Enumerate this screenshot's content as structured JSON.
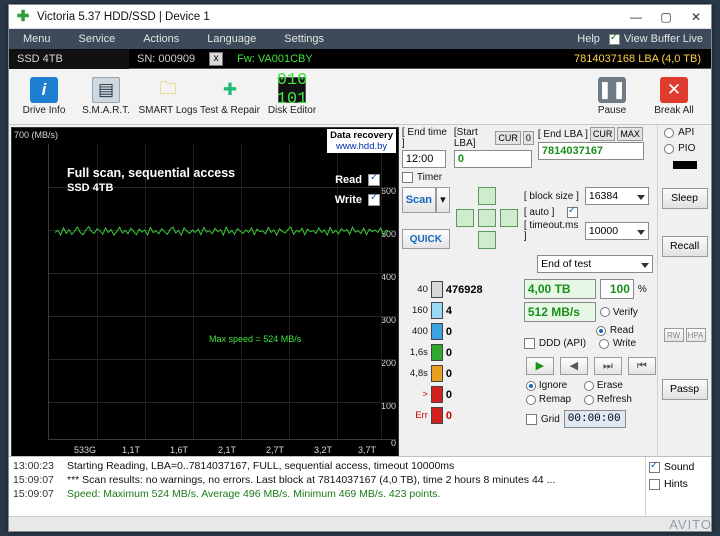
{
  "window": {
    "title": "Victoria 5.37 HDD/SSD | Device 1",
    "logo": "cross-icon",
    "minimize": "—",
    "maximize": "▢",
    "close": "✕"
  },
  "menu": {
    "items": [
      "Menu",
      "Service",
      "Actions",
      "Language",
      "Settings"
    ],
    "help": "Help",
    "view_buffer_live": "View Buffer Live"
  },
  "drivebar": {
    "model": "SSD 4TB",
    "sn_label": "SN: 000909",
    "close_drive": "x",
    "fw": "Fw: VA001CBY",
    "lba": "7814037168 LBA (4,0 TB)"
  },
  "toolbar": {
    "buttons": [
      {
        "label": "Drive Info",
        "icon": "info-icon"
      },
      {
        "label": "S.M.A.R.T.",
        "icon": "smart-table-icon"
      },
      {
        "label": "SMART Logs",
        "icon": "folder-icon"
      },
      {
        "label": "Test & Repair",
        "icon": "tools-icon"
      },
      {
        "label": "Disk Editor",
        "icon": "hex-editor-icon"
      }
    ],
    "pause": {
      "label": "Pause",
      "icon": "pause-icon"
    },
    "break_all": {
      "label": "Break All",
      "icon": "stop-icon"
    }
  },
  "graph": {
    "unit": "700 (MB/s)",
    "y_ticks": [
      "600",
      "500",
      "400",
      "300",
      "200",
      "100",
      "0"
    ],
    "x_ticks": [
      "533G",
      "1,1T",
      "1,6T",
      "2,1T",
      "2,7T",
      "3,2T",
      "3,7T"
    ],
    "title": "Full scan, sequential access",
    "subtitle": "SSD 4TB",
    "read_label": "Read",
    "write_label": "Write",
    "watermark_top": "Data recovery",
    "watermark_bottom": "www.hdd.by",
    "max_speed_note": "Max speed = 524 MB/s"
  },
  "chart_data": {
    "type": "line",
    "title": "Full scan, sequential access",
    "xlabel": "",
    "ylabel": "MB/s",
    "ylim": [
      0,
      700
    ],
    "x_tick_labels": [
      "533G",
      "1,1T",
      "1,6T",
      "2,1T",
      "2,7T",
      "3,2T",
      "3,7T"
    ],
    "y_tick_labels": [
      "700",
      "600",
      "500",
      "400",
      "300",
      "200",
      "100",
      "0"
    ],
    "series": [
      {
        "name": "Read",
        "color": "#35c935",
        "values": [
          492,
          497,
          486,
          503,
          490,
          499,
          488,
          495,
          505,
          492,
          487,
          498,
          506,
          494,
          490,
          501,
          496,
          488,
          503,
          492,
          499,
          486,
          494,
          505,
          491,
          497,
          489,
          502,
          495,
          487,
          500,
          493,
          498,
          486,
          504,
          492,
          496,
          489,
          501,
          494,
          488,
          499,
          505,
          491,
          497,
          486,
          503,
          495,
          490,
          498,
          492,
          500,
          487,
          504,
          493,
          496,
          489,
          502,
          494,
          499,
          486,
          505,
          491,
          497,
          488,
          501,
          495,
          490,
          498,
          492,
          503,
          487,
          500,
          494,
          496,
          489,
          504,
          492,
          498,
          486,
          501,
          495,
          491,
          499,
          505,
          488,
          497,
          493,
          502,
          487,
          500,
          494,
          496,
          490,
          503,
          492,
          498,
          486,
          504,
          491,
          497,
          489,
          501,
          495,
          499,
          488,
          505,
          493,
          496,
          490,
          502,
          487,
          500,
          494,
          498,
          492,
          503,
          486,
          497,
          495
        ]
      }
    ],
    "annotations": [
      "Max speed = 524 MB/s"
    ],
    "grid": true,
    "legend_position": "top-right"
  },
  "controls": {
    "end_time_label": "[ End time ]",
    "end_time_value": "12:00",
    "start_lba_label": "[Start LBA]",
    "start_lba_cur": "CUR",
    "start_lba_zero": "0",
    "start_lba_value": "0",
    "end_lba_label": "[ End LBA ]",
    "end_lba_cur": "CUR",
    "end_lba_max": "MAX",
    "end_lba_value": "7814037167",
    "timer_label": "Timer",
    "scan_button": "Scan",
    "quick_button": "QUICK",
    "block_size_label": "[ block size ]",
    "block_size_value": "16384",
    "auto_label": "[ auto ]",
    "timeout_label": "[ timeout.ms ]",
    "timeout_value": "10000",
    "end_of_test": "End of test"
  },
  "blocks": {
    "rows": [
      {
        "time": "40",
        "count": "476928",
        "color": "#d8d8d8"
      },
      {
        "time": "160",
        "count": "4",
        "color": "#9ad9f5"
      },
      {
        "time": "400",
        "count": "0",
        "color": "#3aa3e0"
      },
      {
        "time": "1,6s",
        "count": "0",
        "color": "#2fa82f"
      },
      {
        "time": "4,8s",
        "count": "0",
        "color": "#e8a020"
      },
      {
        "time": ">",
        "count": "0",
        "color": "#d02020"
      },
      {
        "time": "Err",
        "count": "0",
        "color": "#d02020"
      }
    ]
  },
  "stats": {
    "capacity": "4,00 TB",
    "percent": "100",
    "percent_unit": "%",
    "speed": "512 MB/s",
    "verify": "Verify",
    "read": "Read",
    "write": "Write",
    "ddd_api": "DDD (API)",
    "ignore": "Ignore",
    "erase": "Erase",
    "remap": "Remap",
    "refresh": "Refresh",
    "grid": "Grid",
    "timer_display": "00:00:00"
  },
  "sidebar": {
    "api": "API",
    "pio": "PIO",
    "sleep": "Sleep",
    "recall": "Recall",
    "passp": "Passp",
    "small_left": "RW",
    "small_right": "HPA"
  },
  "log": {
    "rows": [
      {
        "time": "13:00:23",
        "text": "Starting Reading, LBA=0..7814037167, FULL, sequential access, timeout 10000ms"
      },
      {
        "time": "15:09:07",
        "text": "*** Scan results: no warnings, no errors. Last block at 7814037167 (4,0 TB), time 2 hours 8 minutes 44 ..."
      },
      {
        "time": "15:09:07",
        "text": "Speed: Maximum 524 MB/s. Average 496 MB/s. Minimum 469 MB/s. 423 points."
      }
    ],
    "sound": "Sound",
    "hints": "Hints"
  },
  "watermark": "AVITO"
}
